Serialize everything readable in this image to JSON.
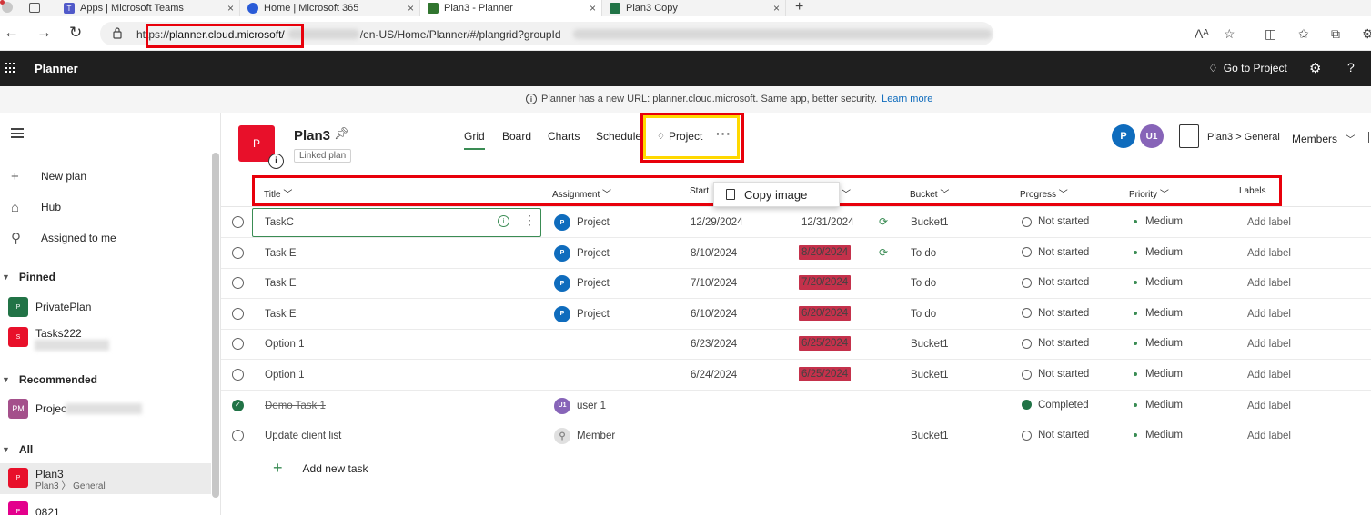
{
  "browser": {
    "tabs": [
      {
        "title": "Apps | Microsoft Teams",
        "color": "#5059c9"
      },
      {
        "title": "Home | Microsoft 365",
        "color": "#2a5bd7"
      },
      {
        "title": "Plan3 - Planner",
        "color": "#31752f"
      },
      {
        "title": "Plan3 Copy",
        "color": "#217346"
      }
    ],
    "url_prefix": "https://",
    "url_highlight": "planner.cloud.microsoft/",
    "url_rest": "/en-US/Home/Planner/#/plangrid?groupId"
  },
  "app": {
    "name": "Planner",
    "goto_project": "Go to Project"
  },
  "banner": {
    "text": "Planner has a new URL: planner.cloud.microsoft. Same app, better security.",
    "link": "Learn more"
  },
  "sidebar": {
    "nav": [
      {
        "label": "New plan",
        "icon": "plus-icon"
      },
      {
        "label": "Hub",
        "icon": "home-icon"
      },
      {
        "label": "Assigned to me",
        "icon": "person-icon"
      }
    ],
    "sections": {
      "pinned": "Pinned",
      "recommended": "Recommended",
      "all": "All"
    },
    "pinned": [
      {
        "name": "PrivatePlan",
        "initials": "P",
        "color": "#217346"
      },
      {
        "name": "Tasks222",
        "initials": "S",
        "color": "#e8102a"
      }
    ],
    "recommended": [
      {
        "name": "Projec",
        "initials": "PM",
        "color": "#a4508b"
      }
    ],
    "all": [
      {
        "name": "Plan3",
        "initials": "P",
        "color": "#e8102a",
        "sub_plan": "Plan3",
        "sub_group": "General"
      },
      {
        "name": "0821",
        "initials": "P",
        "color": "#e3008c"
      }
    ]
  },
  "plan": {
    "initial": "P",
    "title": "Plan3",
    "linked": "Linked plan",
    "tabs": [
      "Grid",
      "Board",
      "Charts",
      "Schedule"
    ],
    "project_tab": "Project",
    "more": "···",
    "avatars": [
      {
        "initials": "P",
        "color": "#0f6cbd"
      },
      {
        "initials": "U1",
        "color": "#8764b8"
      }
    ],
    "breadcrumb": "Plan3 > General",
    "members": "Members"
  },
  "grid": {
    "headers": [
      "Title",
      "Assignment",
      "Start",
      "Bucket",
      "Progress",
      "Priority",
      "Labels"
    ],
    "rows": [
      {
        "title": "TaskC",
        "assignee": "Project",
        "av": "P",
        "av_color": "#0f6cbd",
        "start": "12/29/2024",
        "due": "12/31/2024",
        "late": false,
        "repeat": true,
        "bucket": "Bucket1",
        "progress": "Not started",
        "priority": "Medium",
        "labels": "Add label"
      },
      {
        "title": "Task E",
        "assignee": "Project",
        "av": "P",
        "av_color": "#0f6cbd",
        "start": "8/10/2024",
        "due": "8/20/2024",
        "late": true,
        "repeat": true,
        "bucket": "To do",
        "progress": "Not started",
        "priority": "Medium",
        "labels": "Add label"
      },
      {
        "title": "Task E",
        "assignee": "Project",
        "av": "P",
        "av_color": "#0f6cbd",
        "start": "7/10/2024",
        "due": "7/20/2024",
        "late": true,
        "repeat": false,
        "bucket": "To do",
        "progress": "Not started",
        "priority": "Medium",
        "labels": "Add label"
      },
      {
        "title": "Task E",
        "assignee": "Project",
        "av": "P",
        "av_color": "#0f6cbd",
        "start": "6/10/2024",
        "due": "6/20/2024",
        "late": true,
        "repeat": false,
        "bucket": "To do",
        "progress": "Not started",
        "priority": "Medium",
        "labels": "Add label"
      },
      {
        "title": "Option 1",
        "assignee": "",
        "av": "",
        "av_color": "",
        "start": "6/23/2024",
        "due": "6/25/2024",
        "late": true,
        "repeat": false,
        "bucket": "Bucket1",
        "progress": "Not started",
        "priority": "Medium",
        "labels": "Add label"
      },
      {
        "title": "Option 1",
        "assignee": "",
        "av": "",
        "av_color": "",
        "start": "6/24/2024",
        "due": "6/25/2024",
        "late": true,
        "repeat": false,
        "bucket": "Bucket1",
        "progress": "Not started",
        "priority": "Medium",
        "labels": "Add label"
      },
      {
        "title": "Demo Task 1",
        "assignee": "user 1",
        "av": "U1",
        "av_color": "#8764b8",
        "start": "",
        "due": "",
        "late": false,
        "repeat": false,
        "bucket": "",
        "progress": "Completed",
        "priority": "Medium",
        "labels": "Add label",
        "done": true
      },
      {
        "title": "Update client list",
        "assignee": "Member",
        "av": "",
        "av_color": "#e0e0e0",
        "start": "",
        "due": "",
        "late": false,
        "repeat": false,
        "bucket": "Bucket1",
        "progress": "Not started",
        "priority": "Medium",
        "labels": "Add label"
      }
    ],
    "add_task": "Add new task"
  },
  "popup": {
    "label": "Copy image"
  },
  "colors": {
    "accent_green": "#3a8c54",
    "late_red": "#c4314b",
    "annotation_red": "#e8000b",
    "annotation_yellow": "#ffd800"
  }
}
